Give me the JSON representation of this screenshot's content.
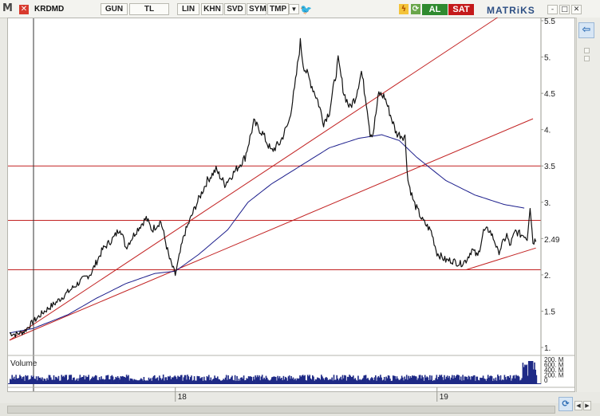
{
  "toolbar": {
    "logo": "M",
    "close_glyph": "✕",
    "symbol": "KRDMD",
    "buttons": [
      "GUN",
      "TL",
      "LIN",
      "KHN",
      "SVD",
      "SYM",
      "TMP"
    ],
    "dropdown_glyph": "▼",
    "twitter_glyph": "🐦",
    "buy": "AL",
    "sell": "SAT",
    "brand": "MATRiKS",
    "window_controls": [
      "-",
      "□",
      "✕"
    ]
  },
  "side": {
    "back_arrow": "⇦"
  },
  "bottom": {
    "nav_left": "◀",
    "nav_right": "▶",
    "refresh_glyph": "⟳"
  },
  "chart_data": {
    "type": "line",
    "symbol": "KRDMD",
    "price_axis": {
      "min": 1.0,
      "max": 5.5,
      "ticks": [
        1,
        1.5,
        2,
        2.5,
        3,
        3.5,
        4,
        4.5,
        5,
        5.5
      ],
      "tick_labels": [
        "1.",
        "1.5",
        "2.",
        "2.49",
        "3.",
        "3.5",
        "4.",
        "4.5",
        "5.",
        "5.5"
      ],
      "last_value_label": "2.49"
    },
    "time_axis_labels": [
      {
        "label": "18",
        "index": 57
      },
      {
        "label": "19",
        "index": 147
      }
    ],
    "n_points": 180,
    "series": [
      {
        "name": "price",
        "color": "#111111",
        "anchors": [
          [
            0,
            1.2
          ],
          [
            2,
            1.18
          ],
          [
            5,
            1.22
          ],
          [
            8,
            1.35
          ],
          [
            12,
            1.5
          ],
          [
            16,
            1.62
          ],
          [
            20,
            1.76
          ],
          [
            24,
            1.9
          ],
          [
            28,
            2.02
          ],
          [
            32,
            2.35
          ],
          [
            36,
            2.52
          ],
          [
            38,
            2.65
          ],
          [
            40,
            2.38
          ],
          [
            44,
            2.63
          ],
          [
            47,
            2.78
          ],
          [
            49,
            2.62
          ],
          [
            52,
            2.74
          ],
          [
            55,
            2.22
          ],
          [
            57,
            2.0
          ],
          [
            60,
            2.55
          ],
          [
            64,
            2.95
          ],
          [
            68,
            3.3
          ],
          [
            71,
            3.45
          ],
          [
            74,
            3.25
          ],
          [
            77,
            3.4
          ],
          [
            81,
            3.62
          ],
          [
            84,
            4.1
          ],
          [
            87,
            3.95
          ],
          [
            90,
            3.7
          ],
          [
            93,
            3.82
          ],
          [
            96,
            4.1
          ],
          [
            98,
            4.55
          ],
          [
            100,
            5.2
          ],
          [
            101,
            4.9
          ],
          [
            103,
            4.7
          ],
          [
            106,
            4.4
          ],
          [
            108,
            4.1
          ],
          [
            110,
            4.25
          ],
          [
            113,
            4.95
          ],
          [
            115,
            4.5
          ],
          [
            117,
            4.3
          ],
          [
            119,
            4.45
          ],
          [
            121,
            4.8
          ],
          [
            123,
            4.3
          ],
          [
            124,
            3.95
          ],
          [
            125,
            3.95
          ],
          [
            127,
            4.5
          ],
          [
            129,
            4.45
          ],
          [
            131,
            4.2
          ],
          [
            133,
            3.95
          ],
          [
            136,
            3.9
          ],
          [
            137,
            3.3
          ],
          [
            139,
            3.0
          ],
          [
            142,
            2.75
          ],
          [
            145,
            2.6
          ],
          [
            147,
            2.3
          ],
          [
            150,
            2.2
          ],
          [
            152,
            2.2
          ],
          [
            155,
            2.15
          ],
          [
            157,
            2.2
          ],
          [
            159,
            2.35
          ],
          [
            161,
            2.25
          ],
          [
            163,
            2.6
          ],
          [
            165,
            2.62
          ],
          [
            167,
            2.45
          ],
          [
            168,
            2.3
          ],
          [
            171,
            2.55
          ],
          [
            172,
            2.4
          ],
          [
            174,
            2.6
          ],
          [
            176,
            2.55
          ],
          [
            177,
            2.55
          ],
          [
            178,
            2.5
          ],
          [
            179,
            2.95
          ],
          [
            180,
            2.45
          ],
          [
            181,
            2.49
          ]
        ]
      },
      {
        "name": "moving_average",
        "color": "#1c1e8c",
        "anchors": [
          [
            0,
            1.2
          ],
          [
            8,
            1.26
          ],
          [
            20,
            1.45
          ],
          [
            30,
            1.68
          ],
          [
            40,
            1.88
          ],
          [
            50,
            2.02
          ],
          [
            57,
            2.05
          ],
          [
            65,
            2.28
          ],
          [
            75,
            2.62
          ],
          [
            82,
            3.0
          ],
          [
            90,
            3.25
          ],
          [
            100,
            3.5
          ],
          [
            110,
            3.75
          ],
          [
            120,
            3.88
          ],
          [
            128,
            3.93
          ],
          [
            134,
            3.85
          ],
          [
            140,
            3.62
          ],
          [
            150,
            3.3
          ],
          [
            160,
            3.1
          ],
          [
            170,
            2.97
          ],
          [
            177,
            2.92
          ]
        ]
      }
    ],
    "horizontal_lines": [
      3.5,
      2.75,
      2.07
    ],
    "trend_lines": [
      {
        "from": [
          0,
          1.1
        ],
        "to": [
          168,
          5.55
        ]
      },
      {
        "from": [
          0,
          1.1
        ],
        "to": [
          180,
          4.15
        ]
      },
      {
        "from": [
          157,
          2.07
        ],
        "to": [
          181,
          2.37
        ]
      }
    ],
    "volume": {
      "label": "Volume",
      "axis_labels": [
        "200. M",
        "600. M",
        "400. M",
        "200. M",
        "0"
      ]
    },
    "grid": false
  }
}
